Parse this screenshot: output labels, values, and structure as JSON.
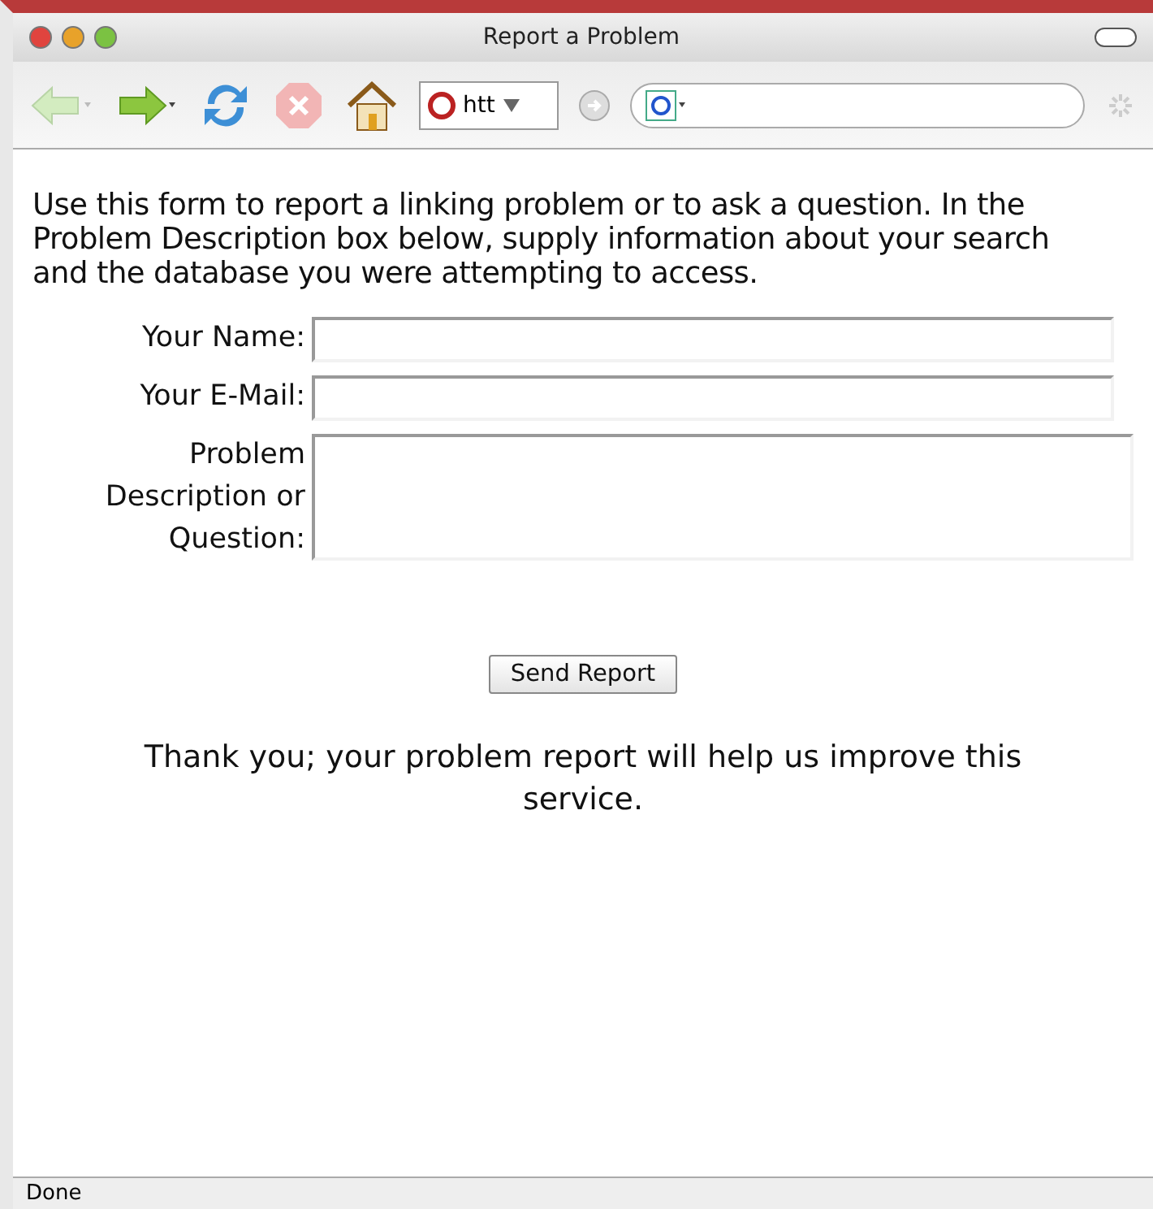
{
  "window": {
    "title": "Report a Problem"
  },
  "toolbar": {
    "address": "htt"
  },
  "intro": "Use this form to report a linking problem or to ask a question. In the Problem Description box below, supply information about your search and the database you were attempting to access.",
  "fields": [
    {
      "label": "Your Name:",
      "kind": "line"
    },
    {
      "label": "Your E-Mail:",
      "kind": "line"
    },
    {
      "label": "Problem Description or Question:",
      "kind": "area"
    }
  ],
  "submit": "Send Report",
  "thanks": "Thank you; your problem report will help us improve this service.",
  "status_bar": "Done"
}
